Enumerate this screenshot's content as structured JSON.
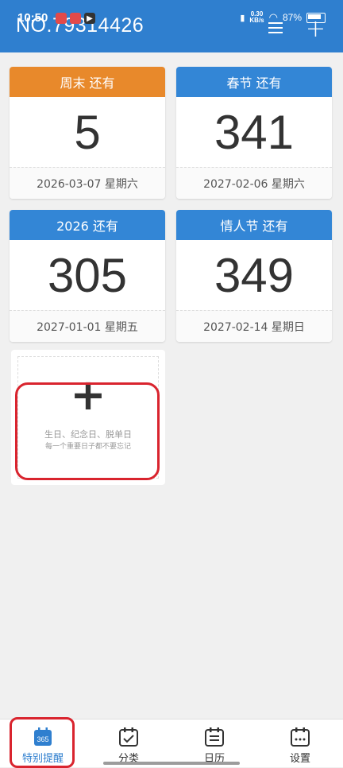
{
  "status_bar": {
    "time": "10:50",
    "net_speed_value": "0.30",
    "net_speed_unit": "KB/s",
    "battery_percent": "87%"
  },
  "header": {
    "title": "NO.79314426"
  },
  "cards": [
    {
      "label": "周末 还有",
      "days": "5",
      "date": "2026-03-07 星期六",
      "color": "#e8892b"
    },
    {
      "label": "春节 还有",
      "days": "341",
      "date": "2027-02-06 星期六",
      "color": "#3386d6"
    },
    {
      "label": "2026 还有",
      "days": "305",
      "date": "2027-01-01 星期五",
      "color": "#3386d6"
    },
    {
      "label": "情人节 还有",
      "days": "349",
      "date": "2027-02-14 星期日",
      "color": "#3386d6"
    }
  ],
  "add_card": {
    "plus": "+",
    "line1": "生日、纪念日、脱单日",
    "line2": "每一个重要日子都不要忘记"
  },
  "tabs": [
    {
      "label": "特别提醒",
      "icon": "calendar-365-icon",
      "badge": "365"
    },
    {
      "label": "分类",
      "icon": "calendar-check-icon"
    },
    {
      "label": "日历",
      "icon": "calendar-list-icon"
    },
    {
      "label": "设置",
      "icon": "calendar-dots-icon"
    }
  ],
  "colors": {
    "header": "#2f7fcf",
    "orange": "#e8892b",
    "blue": "#3386d6",
    "highlight": "#d9242e"
  }
}
